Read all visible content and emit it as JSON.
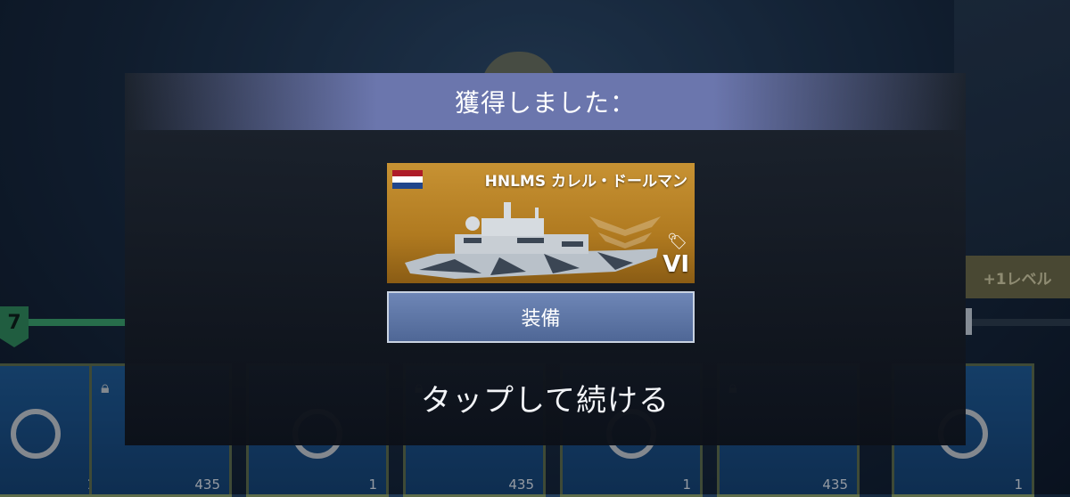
{
  "background": {
    "level_number": "7",
    "next_reward_label": "+1レベル",
    "cards": [
      {
        "count": "1",
        "type": "check"
      },
      {
        "count": "435",
        "type": "coins"
      },
      {
        "count": "1",
        "type": "check"
      },
      {
        "count": "435",
        "type": "coins"
      },
      {
        "count": "1",
        "type": "check"
      },
      {
        "count": "435",
        "type": "coins"
      },
      {
        "count": "1",
        "type": "check"
      }
    ]
  },
  "modal": {
    "title": "獲得しました：",
    "ship": {
      "name": "HNLMS カレル・ドールマン",
      "tier": "VI",
      "flag_colors": [
        "#ae1c28",
        "#ffffff",
        "#21468b"
      ],
      "card_color": "#c79233"
    },
    "equip_label": "装備",
    "continue_label": "タップして続ける"
  }
}
